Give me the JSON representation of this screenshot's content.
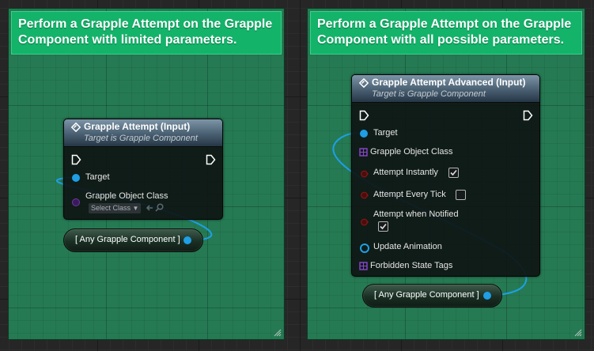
{
  "comments": [
    {
      "line1": "Perform a Grapple Attempt on the Grapple",
      "line2": "Component with limited parameters."
    },
    {
      "line1": "Perform a Grapple Attempt on the Grapple",
      "line2": "Component with all possible parameters."
    }
  ],
  "node_simple": {
    "title": "Grapple Attempt (Input)",
    "subtitle": "Target is Grapple Component",
    "target_label": "Target",
    "class_label": "Grapple Object Class",
    "class_select": "Select Class"
  },
  "node_advanced": {
    "title": "Grapple Attempt Advanced (Input)",
    "subtitle": "Target is Grapple Component",
    "target_label": "Target",
    "class_label": "Grapple Object Class",
    "attempt_instantly_label": "Attempt Instantly",
    "attempt_instantly_checked": true,
    "attempt_every_tick_label": "Attempt Every Tick",
    "attempt_every_tick_checked": false,
    "attempt_when_notified_label": "Attempt when Notified",
    "attempt_when_notified_checked": true,
    "update_animation_label": "Update Animation",
    "forbidden_tags_label": "Forbidden State Tags"
  },
  "reroutes": [
    {
      "label": "[ Any Grapple Component ]"
    },
    {
      "label": "[ Any Grapple Component ]"
    }
  ],
  "colors": {
    "wire": "#1e9fe6",
    "class_pin": "#5a2a8a",
    "bool_pin": "#8a1414",
    "comment_header": "#13b36a",
    "comment_body": "#257a53"
  }
}
